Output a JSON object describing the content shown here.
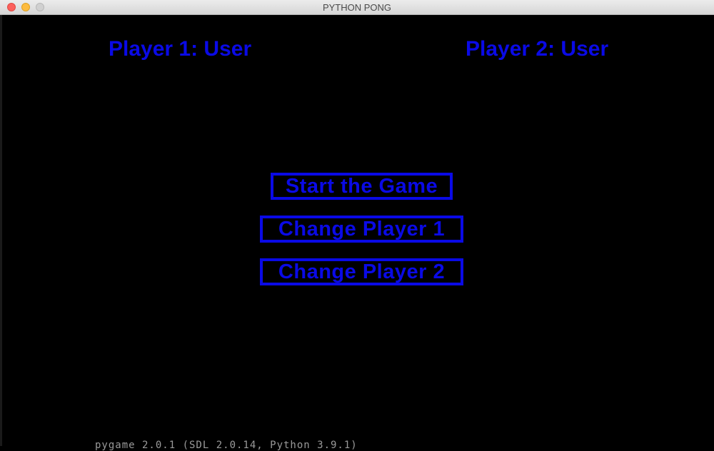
{
  "window": {
    "title": "PYTHON PONG"
  },
  "players": {
    "player1_label": "Player 1: User",
    "player2_label": "Player 2: User"
  },
  "menu": {
    "start_label": "Start the Game",
    "change_player1_label": "Change Player 1",
    "change_player2_label": "Change Player 2"
  },
  "footer": {
    "version_text": "pygame 2.0.1 (SDL 2.0.14, Python 3.9.1)"
  },
  "colors": {
    "text_accent": "#0a0ae6",
    "background": "#000000",
    "titlebar": "#e4e4e4"
  }
}
